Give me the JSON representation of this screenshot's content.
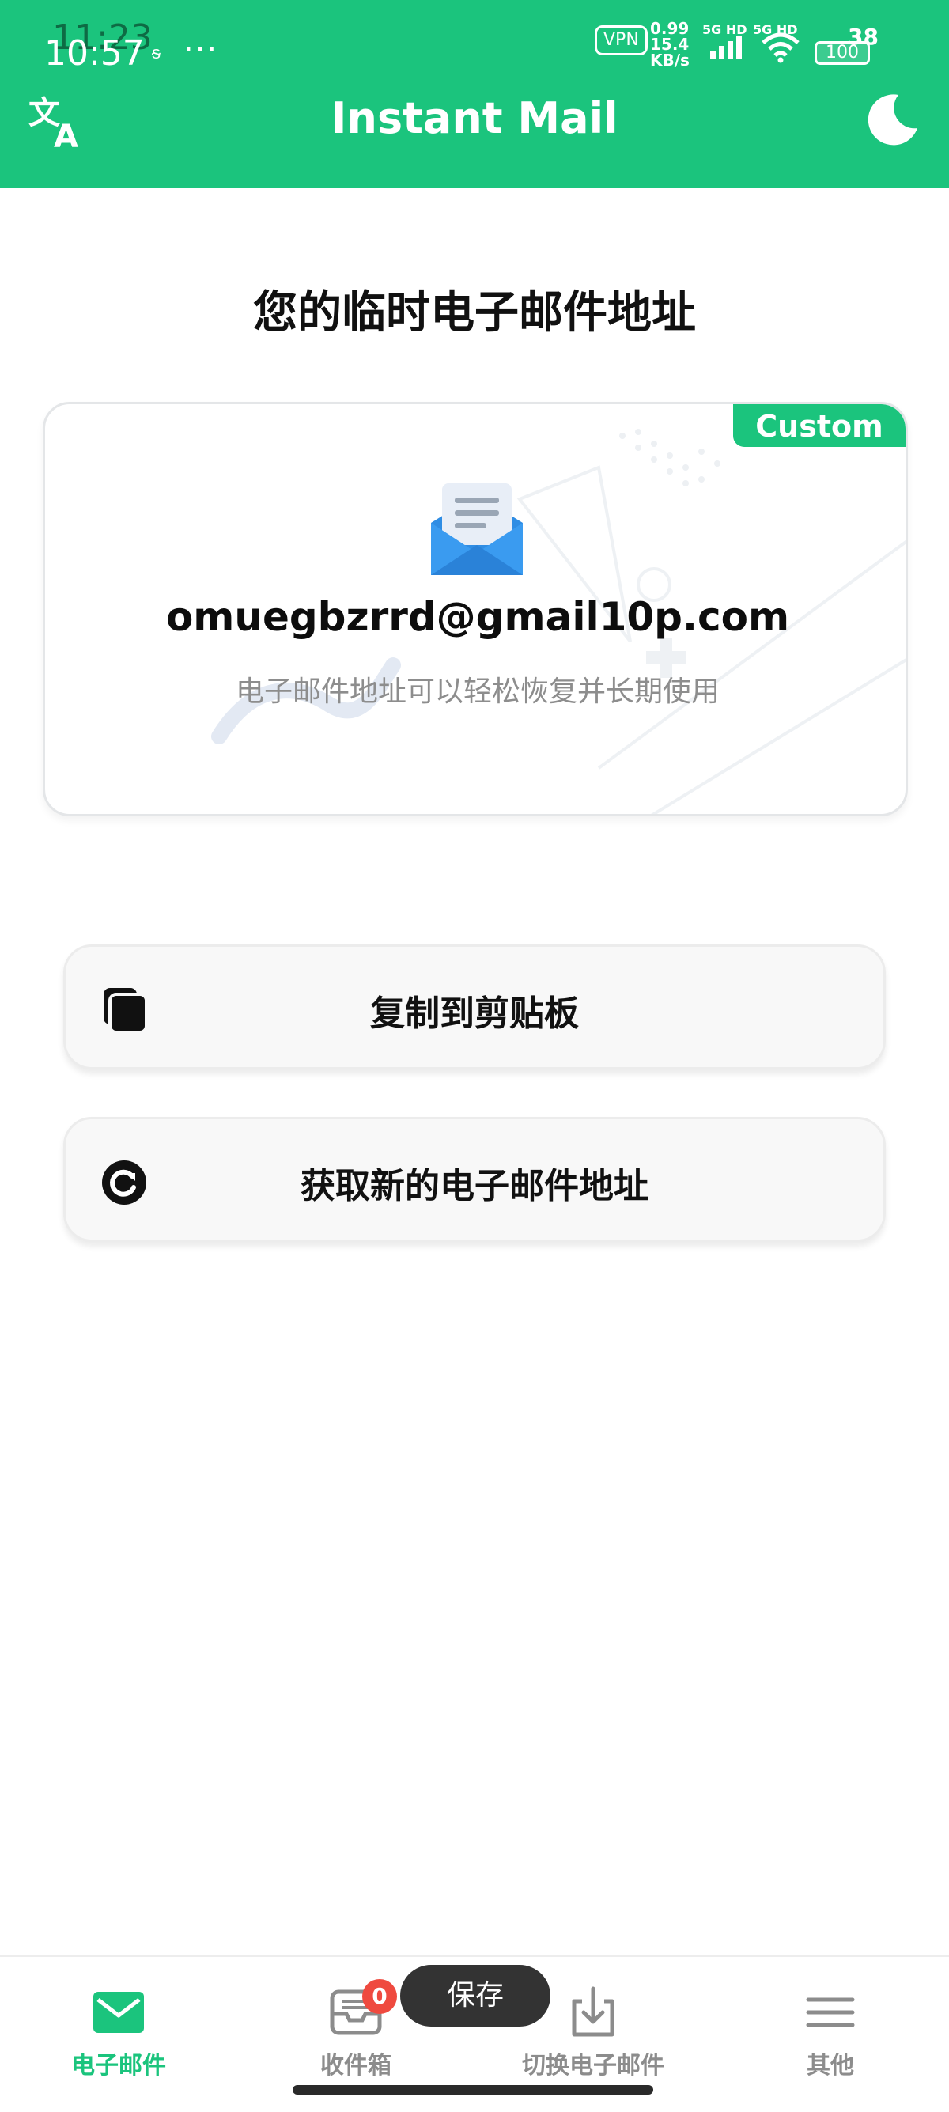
{
  "status_bar": {
    "time": "10:57",
    "time_ghost": "11:23",
    "dots": "···",
    "vpn": "VPN",
    "rate_top": "0.99",
    "rate_value": "15.4",
    "rate_unit": "KB/s",
    "signal1": "5G HD",
    "signal2": "5G HD",
    "battery": "100",
    "battery2": "38"
  },
  "header": {
    "title": "Instant Mail",
    "translate_icon": "translate-icon",
    "theme_icon": "moon-icon"
  },
  "main": {
    "title": "您的临时电子邮件地址",
    "card": {
      "badge": "Custom",
      "email": "omuegbzrrd@gmail10p.com",
      "subtitle": "电子邮件地址可以轻松恢复并长期使用",
      "icon": "envelope-icon"
    },
    "buttons": [
      {
        "label": "复制到剪贴板",
        "icon": "copy-icon"
      },
      {
        "label": "获取新的电子邮件地址",
        "icon": "refresh-icon"
      }
    ]
  },
  "bottom_nav": {
    "items": [
      {
        "label": "电子邮件",
        "icon": "mail-icon",
        "active": true
      },
      {
        "label": "收件箱",
        "icon": "inbox-icon",
        "active": false,
        "badge": "0"
      },
      {
        "label": "切换电子邮件",
        "icon": "download-icon",
        "active": false
      },
      {
        "label": "其他",
        "icon": "menu-icon",
        "active": false
      }
    ],
    "save_chip": "保存"
  },
  "colors": {
    "accent": "#1bc47d",
    "badge_red": "#ef4a3f",
    "icon_blue": "#2f8de4"
  }
}
